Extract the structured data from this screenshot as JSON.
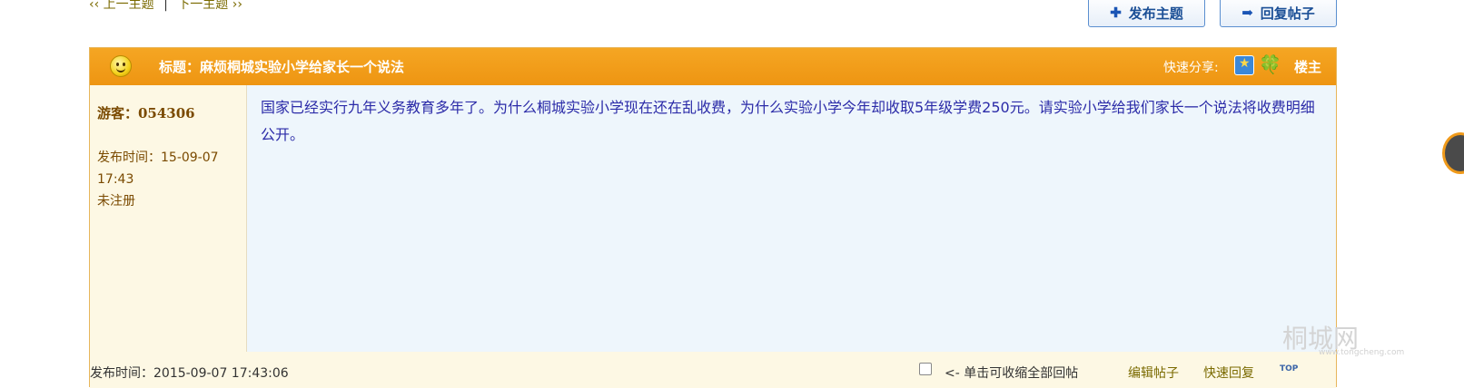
{
  "topnav": {
    "prev": "‹‹ 上一主题",
    "separator": "|",
    "next": "下一主题 ››"
  },
  "buttons": {
    "new_topic": "发布主题",
    "reply": "回复帖子"
  },
  "post": {
    "title": "标题：麻烦桐城实验小学给家长一个说法",
    "share_label": "快速分享:",
    "floor": "楼主",
    "author": "游客：054306",
    "posted_time": "发布时间：15-09-07 17:43",
    "registration": "未注册",
    "body": "国家已经实行九年义务教育多年了。为什么桐城实验小学现在还在乱收费，为什么实验小学今年却收取5年级学费250元。请实验小学给我们家长一个说法将收费明细公开。"
  },
  "footer": {
    "time": "发布时间：2015-09-07 17:43:06",
    "collapse_label": "<- 单击可收缩全部回帖",
    "edit": "编辑帖子",
    "quick_reply": "快速回复",
    "top": "TOP"
  },
  "watermark": {
    "brand": "桐城网",
    "url": "www.tongcheng.com"
  },
  "colors": {
    "header": "#f0a11e",
    "content_bg": "#eef6fc",
    "body_text": "#2b2ba8",
    "side_bg": "#fdf8e4"
  }
}
